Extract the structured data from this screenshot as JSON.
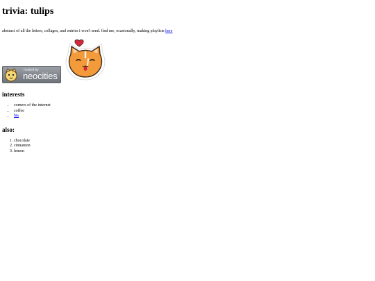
{
  "page": {
    "title": "trivia: tulips",
    "intro_text": "abstract of all the letters, collages, and entries i won't send. find me, ocasionally, making playlists",
    "intro_link": "here"
  },
  "badges": {
    "neocities_hosted_label": "hosted by",
    "neocities_brand": "neocities"
  },
  "interests": {
    "heading": "interests",
    "items": [
      {
        "label": "corners of the internet",
        "is_link": false
      },
      {
        "label": "coffee",
        "is_link": false
      },
      {
        "label": "bts",
        "is_link": true
      }
    ]
  },
  "also": {
    "heading": "also:",
    "items": [
      "chocolate",
      "cinnamon",
      "lemon"
    ]
  },
  "colors": {
    "link": "#0000ee",
    "cat_orange": "#f39a3b",
    "heart": "#d7263d"
  }
}
